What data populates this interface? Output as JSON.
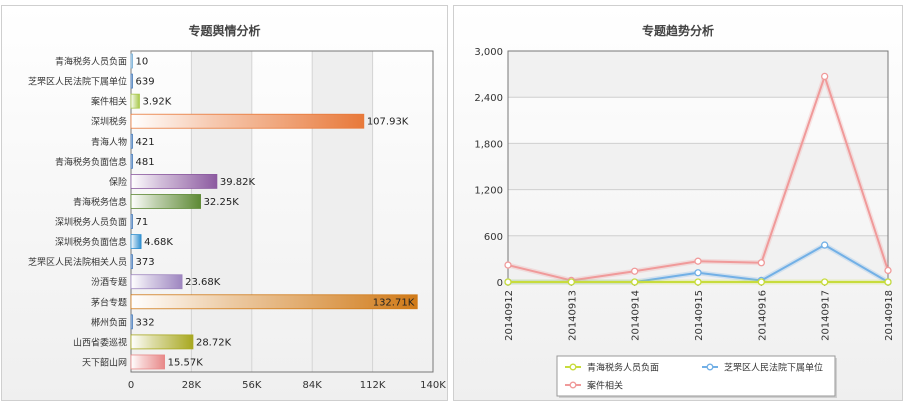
{
  "chart_data": [
    {
      "type": "bar",
      "orientation": "horizontal",
      "title": "专题舆情分析",
      "categories": [
        "青海税务人员负面",
        "芝罘区人民法院下属单位",
        "案件相关",
        "深圳税务",
        "青海人物",
        "青海税务负面信息",
        "保险",
        "青海税务信息",
        "深圳税务人员负面",
        "深圳税务负面信息",
        "芝罘区人民法院相关人员",
        "汾酒专题",
        "茅台专题",
        "郴州负面",
        "山西省委巡视",
        "天下韶山网"
      ],
      "values": [
        10,
        639,
        3920,
        107930,
        421,
        481,
        39820,
        32250,
        71,
        4680,
        373,
        23680,
        132710,
        332,
        28720,
        15570
      ],
      "value_labels": [
        "10",
        "639",
        "3.92K",
        "107.93K",
        "421",
        "481",
        "39.82K",
        "32.25K",
        "71",
        "4.68K",
        "373",
        "23.68K",
        "132.71K",
        "332",
        "28.72K",
        "15.57K"
      ],
      "colors": [
        "#7ab0d6",
        "#4f81bd",
        "#a8c84a",
        "#e8793a",
        "#4f81bd",
        "#4f81bd",
        "#8c5aa0",
        "#5e8a35",
        "#4f81bd",
        "#2f8fd0",
        "#4f81bd",
        "#9e86c0",
        "#d07a18",
        "#4f81bd",
        "#a8a820",
        "#e88888"
      ],
      "x_ticks": [
        "0",
        "28K",
        "56K",
        "84K",
        "112K",
        "140K"
      ],
      "xlim": [
        0,
        140000
      ],
      "grid": true
    },
    {
      "type": "line",
      "title": "专题趋势分析",
      "x": [
        "20140912",
        "20140913",
        "20140914",
        "20140915",
        "20140916",
        "20140917",
        "20140918"
      ],
      "series": [
        {
          "name": "青海税务人员负面",
          "color": "#c8dc3c",
          "values": [
            0,
            0,
            0,
            0,
            0,
            0,
            0
          ]
        },
        {
          "name": "芝罘区人民法院下属单位",
          "color": "#72b0e6",
          "values": [
            0,
            0,
            0,
            120,
            20,
            480,
            0
          ]
        },
        {
          "name": "案件相关",
          "color": "#f09a9a",
          "values": [
            220,
            20,
            140,
            270,
            250,
            2670,
            150
          ]
        }
      ],
      "y_ticks": [
        "0",
        "600",
        "1,200",
        "1,800",
        "2,400",
        "3,000"
      ],
      "ylim": [
        0,
        3000
      ],
      "grid": true,
      "legend_position": "bottom"
    }
  ]
}
